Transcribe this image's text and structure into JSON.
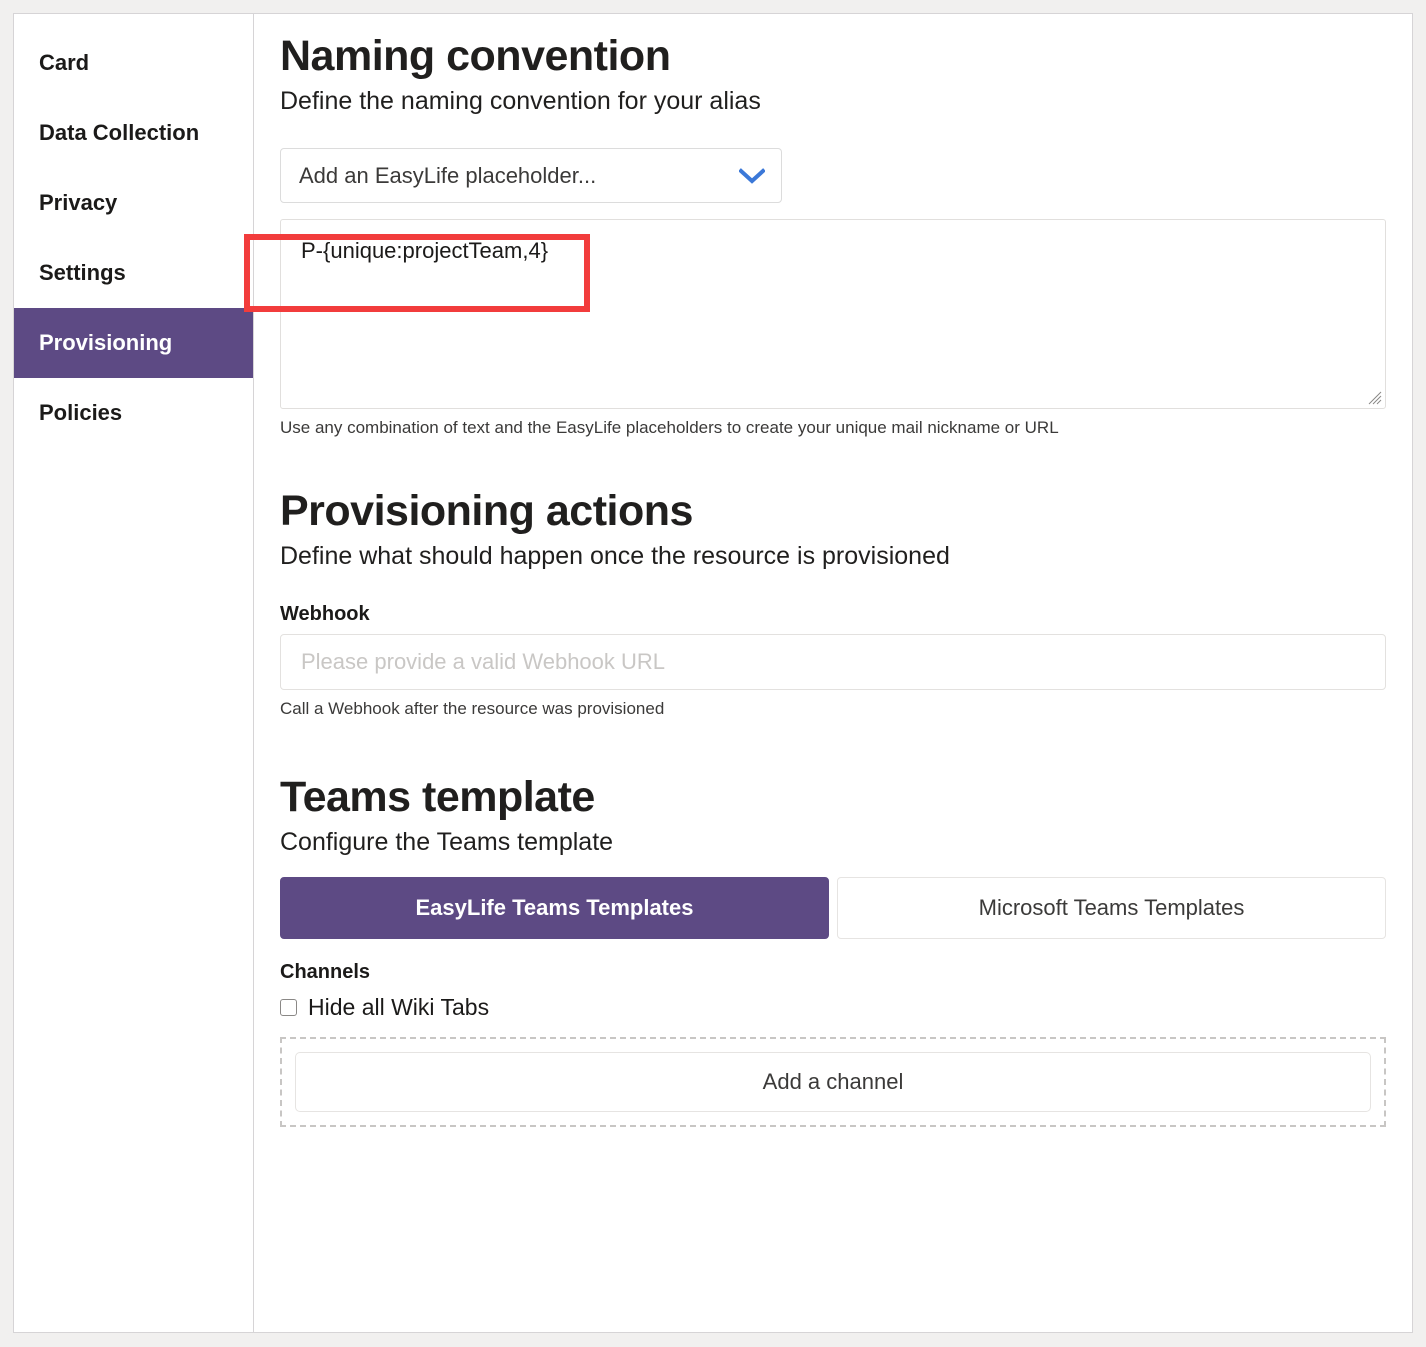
{
  "sidebar": {
    "items": [
      {
        "label": "Card",
        "active": false
      },
      {
        "label": "Data Collection",
        "active": false
      },
      {
        "label": "Privacy",
        "active": false
      },
      {
        "label": "Settings",
        "active": false
      },
      {
        "label": "Provisioning",
        "active": true
      },
      {
        "label": "Policies",
        "active": false
      }
    ]
  },
  "naming_convention": {
    "heading": "Naming convention",
    "subheading": "Define the naming convention for your alias",
    "placeholder_select": {
      "selected": "Add an EasyLife placeholder...",
      "icon": "chevron-down-icon",
      "icon_color": "#3b78d8"
    },
    "pattern_textarea": {
      "value": "P-{unique:projectTeam,4}",
      "placeholder": ""
    },
    "helper": "Use any combination of text and the EasyLife placeholders to create your unique mail nickname or URL"
  },
  "provisioning_actions": {
    "heading": "Provisioning actions",
    "subheading": "Define what should happen once the resource is provisioned",
    "webhook": {
      "label": "Webhook",
      "value": "",
      "placeholder": "Please provide a valid Webhook URL",
      "helper": "Call a Webhook after the resource was provisioned"
    }
  },
  "teams_template": {
    "heading": "Teams template",
    "subheading": "Configure the Teams template",
    "tabs": [
      {
        "label": "EasyLife Teams Templates",
        "selected": true
      },
      {
        "label": "Microsoft Teams Templates",
        "selected": false
      }
    ],
    "channels": {
      "label": "Channels",
      "hide_wiki": {
        "label": "Hide all Wiki Tabs",
        "checked": false
      },
      "add_channel_label": "Add a channel"
    }
  },
  "annotation": {
    "color": "#f23c3c",
    "target": "pattern-textarea"
  },
  "colors": {
    "accent_purple": "#5d4a84",
    "page_background": "#f1f0ef",
    "card_background": "#ffffff",
    "border": "#d6d4d6",
    "link_blue": "#3b78d8",
    "annotation_red": "#f23c3c"
  }
}
